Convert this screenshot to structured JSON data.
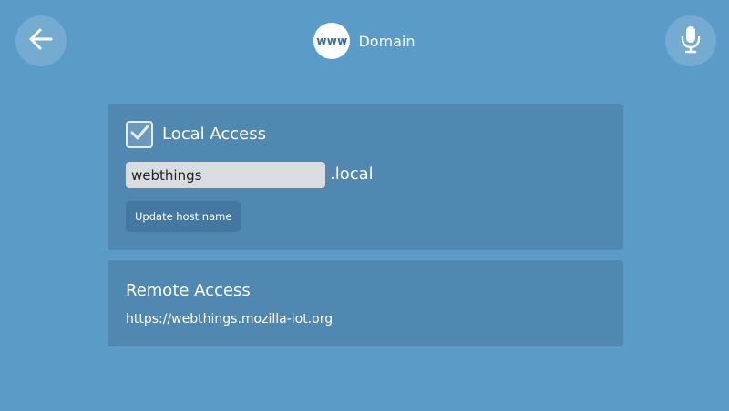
{
  "header": {
    "title": "Domain",
    "badge_text": "www",
    "back_icon": "arrow-left-icon",
    "mic_icon": "microphone-icon"
  },
  "local_access": {
    "checkbox_checked": true,
    "label": "Local Access",
    "host_value": "webthings",
    "suffix": ".local",
    "update_button_label": "Update host name"
  },
  "remote_access": {
    "label": "Remote Access",
    "url": "https://webthings.mozilla-iot.org"
  },
  "colors": {
    "background": "#5b9bc8",
    "panel": "#5088b1",
    "button": "#4578a0",
    "input": "#d9dde2"
  }
}
